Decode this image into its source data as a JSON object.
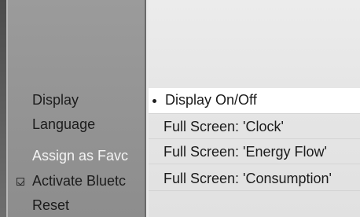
{
  "menu": {
    "items": [
      {
        "label": "Display"
      },
      {
        "label": "Language"
      },
      {
        "label": "Assign as Favc"
      },
      {
        "label": "Activate Bluetc"
      },
      {
        "label": "Reset"
      }
    ]
  },
  "submenu": {
    "items": [
      {
        "label": "Display On/Off"
      },
      {
        "label": "Full Screen: 'Clock'"
      },
      {
        "label": "Full Screen: 'Energy Flow'"
      },
      {
        "label": "Full Screen: 'Consumption'"
      }
    ]
  },
  "icons": {
    "checkbox": "checkbox-icon",
    "bullet": "bullet-icon"
  },
  "colors": {
    "left_panel": "#8f8f8f",
    "right_panel": "#e6e6e6",
    "highlight": "#ffffff",
    "active_text": "#f4f4f4"
  }
}
